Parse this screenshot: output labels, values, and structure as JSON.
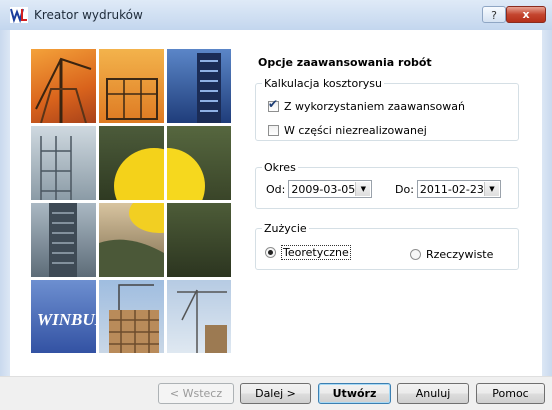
{
  "window": {
    "title": "Kreator wydruków",
    "help_label": "?",
    "close_label": "x"
  },
  "image": {
    "logo_text": "WINBUD"
  },
  "options": {
    "heading": "Opcje zaawansowania robót",
    "costing": {
      "legend": "Kalkulacja kosztorysu",
      "with_progress": {
        "label": "Z wykorzystaniem zaawansowań",
        "checked": true
      },
      "partially_unrealized": {
        "label": "W części niezrealizowanej",
        "checked": false
      }
    },
    "period": {
      "legend": "Okres",
      "from_label": "Od:",
      "from_value": "2009-03-05",
      "to_label": "Do:",
      "to_value": "2011-02-23"
    },
    "usage": {
      "legend": "Zużycie",
      "theoretical": {
        "label": "Teoretyczne",
        "selected": true
      },
      "actual": {
        "label": "Rzeczywiste",
        "selected": false
      }
    }
  },
  "buttons": {
    "back": "< Wstecz",
    "next": "Dalej >",
    "create": "Utwórz",
    "cancel": "Anuluj",
    "help": "Pomoc"
  }
}
